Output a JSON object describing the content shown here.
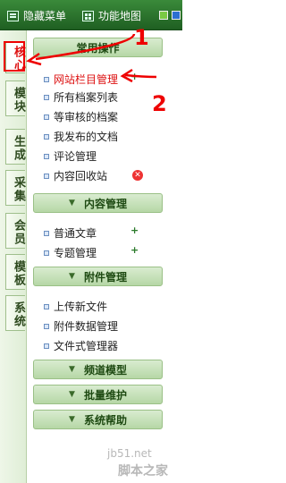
{
  "toolbar": {
    "hide_menu_label": "隐藏菜单",
    "function_map_label": "功能地图"
  },
  "tabs": [
    {
      "label": "核心",
      "active": true
    },
    {
      "label": "模块"
    },
    {
      "label": "生成"
    },
    {
      "label": "采集"
    },
    {
      "label": "会员"
    },
    {
      "label": "模板"
    },
    {
      "label": "系统"
    }
  ],
  "sections": {
    "common": {
      "title": "常用操作"
    },
    "content": {
      "title": "内容管理"
    },
    "attach": {
      "title": "附件管理"
    },
    "channel": {
      "title": "频道模型"
    },
    "batch": {
      "title": "批量维护"
    },
    "help": {
      "title": "系统帮助"
    }
  },
  "common_items": [
    {
      "label": "网站栏目管理"
    },
    {
      "label": "所有档案列表"
    },
    {
      "label": "等审核的档案"
    },
    {
      "label": "我发布的文档"
    },
    {
      "label": "评论管理"
    },
    {
      "label": "内容回收站"
    }
  ],
  "content_items": [
    {
      "label": "普通文章"
    },
    {
      "label": "专题管理"
    }
  ],
  "attach_items": [
    {
      "label": "上传新文件"
    },
    {
      "label": "附件数据管理"
    },
    {
      "label": "文件式管理器"
    }
  ],
  "annotations": {
    "one": "1",
    "two": "2"
  },
  "watermark": {
    "site": "jb51.net",
    "name": "脚本之家"
  },
  "colors": {
    "accent": "#2e7d32",
    "highlight_red": "#e00000"
  }
}
